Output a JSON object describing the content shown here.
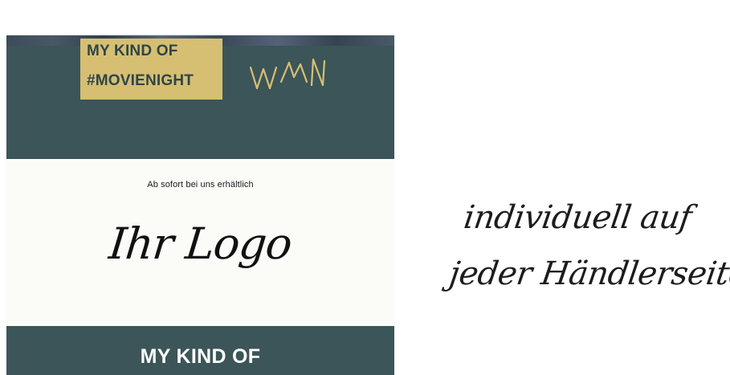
{
  "poster": {
    "tag_line_1": "MY KIND OF",
    "tag_line_2": "#MOVIENIGHT",
    "availability_text": "Ab sofort bei uns erhältlich",
    "logo_placeholder": "Ihr Logo",
    "bottom_title": "MY KIND OF",
    "brand_mark": "WMN",
    "colors": {
      "teal": "#3c5558",
      "gold": "#d6bf72",
      "cream": "#fbfbf8"
    }
  },
  "annotation": {
    "line_1": "individuell auf",
    "line_2": "jeder Händlerseite"
  }
}
